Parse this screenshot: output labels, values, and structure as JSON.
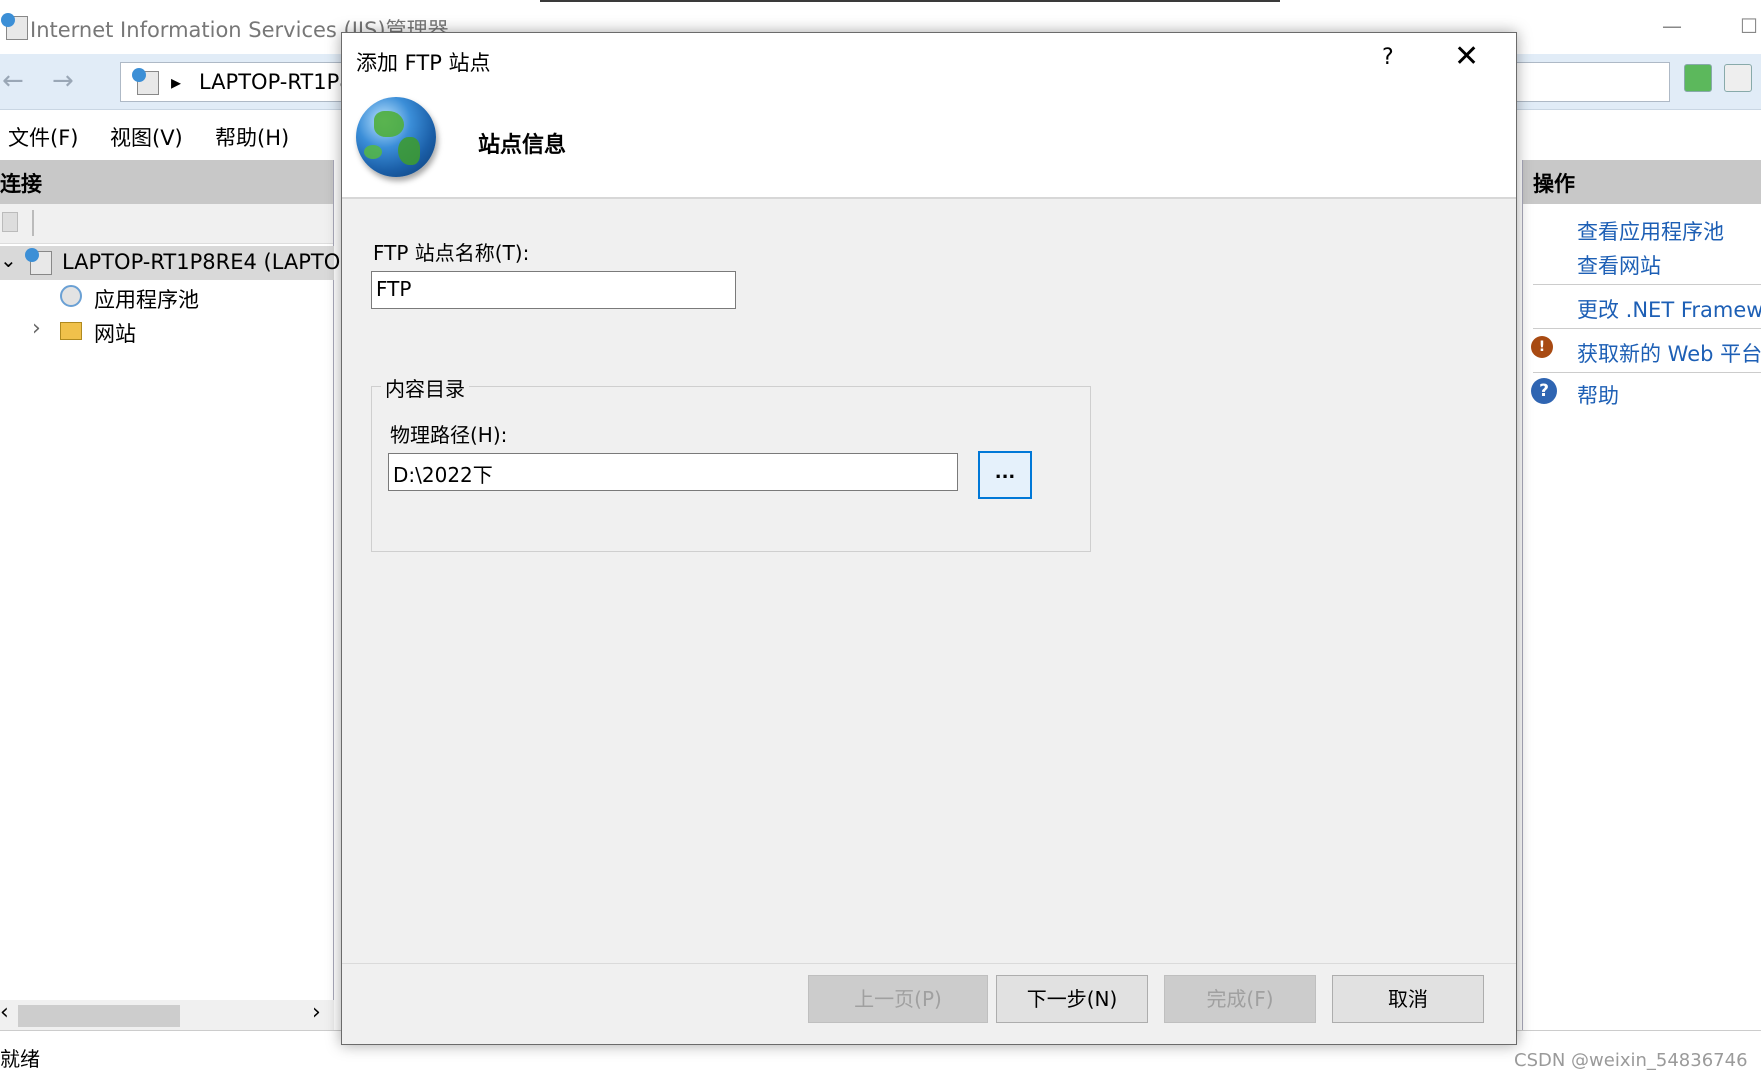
{
  "window": {
    "title": "Internet Information Services (IIS)管理器",
    "minimize_glyph": "—",
    "maximize_glyph": "☐"
  },
  "navbar": {
    "back_glyph": "←",
    "forward_glyph": "→",
    "address_arrow": "▸",
    "address_text": "LAPTOP-RT1P8"
  },
  "menu": {
    "items": [
      {
        "label": "文件(F)"
      },
      {
        "label": "视图(V)"
      },
      {
        "label": "帮助(H)"
      }
    ]
  },
  "connections": {
    "header": "连接",
    "tree": [
      {
        "label": "LAPTOP-RT1P8RE4 (LAPTO",
        "toggle": "⌄"
      },
      {
        "label": "应用程序池"
      },
      {
        "label": "网站",
        "toggle": "›"
      }
    ],
    "scroll_left": "‹",
    "scroll_right": "›"
  },
  "actions": {
    "header": "操作",
    "links": [
      {
        "label": "查看应用程序池"
      },
      {
        "label": "查看网站"
      },
      {
        "label": "更改 .NET Framew"
      },
      {
        "label": "获取新的 Web 平台"
      },
      {
        "label": "帮助"
      }
    ]
  },
  "status": {
    "text": "就绪"
  },
  "dialog": {
    "title": "添加 FTP 站点",
    "help_glyph": "?",
    "close_glyph": "✕",
    "header_title": "站点信息",
    "site_name_label": "FTP 站点名称(T):",
    "site_name_value": "FTP",
    "content_group_label": "内容目录",
    "physical_path_label": "物理路径(H):",
    "physical_path_value": "D:\\2022下",
    "browse_label": "...",
    "buttons": {
      "prev": "上一页(P)",
      "next": "下一步(N)",
      "finish": "完成(F)",
      "cancel": "取消"
    }
  },
  "watermark": "CSDN @weixin_54836746",
  "colors": {
    "link": "#1d5fb5",
    "focus_border": "#0078d7",
    "pane_header": "#c8c8c8"
  }
}
